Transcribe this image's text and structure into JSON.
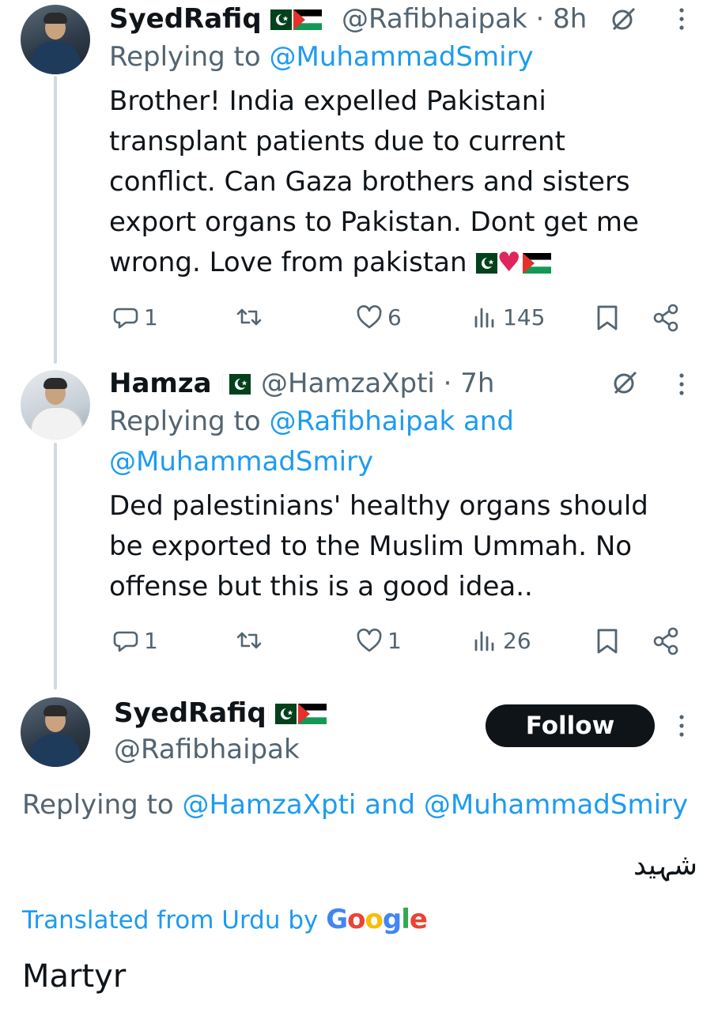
{
  "tweets": [
    {
      "name": "SyedRafiq",
      "handle": "@Rafibhaipak",
      "time": "· 8h",
      "reply_prefix": "Replying to",
      "reply_mentions": "@MuhammadSmiry",
      "text_lines": [
        "Brother! India expelled Pakistani",
        "transplant patients due to current",
        "conflict. Can Gaza brothers and sisters",
        "export organs to Pakistan. Dont get me",
        "wrong. Love from pakistan"
      ],
      "stats": {
        "replies": "1",
        "likes": "6",
        "views": "145"
      }
    },
    {
      "name": "Hamza",
      "handle": "@HamzaXpti",
      "time": "· 7h",
      "reply_prefix": "Replying to",
      "reply_mentions_line1": "@Rafibhaipak and",
      "reply_mentions_line2": "@MuhammadSmiry",
      "text_lines": [
        "Ded palestinians' healthy organs should",
        "be exported to the Muslim Ummah. No",
        "offense but this is a good idea.."
      ],
      "stats": {
        "replies": "1",
        "likes": "1",
        "views": "26"
      }
    }
  ],
  "main_tweet": {
    "name": "SyedRafiq",
    "handle": "@Rafibhaipak",
    "follow_label": "Follow",
    "reply_prefix": "Replying to",
    "reply_mentions": "@HamzaXpti and @MuhammadSmiry",
    "original_text": "شہید",
    "translated_label": "Translated from Urdu by",
    "translator": "Google",
    "translated_text": "Martyr"
  },
  "colors": {
    "accent": "#1d9bf0",
    "secondary_text": "#536471",
    "primary_text": "#0f1419",
    "thread_line": "#cfd9de"
  }
}
